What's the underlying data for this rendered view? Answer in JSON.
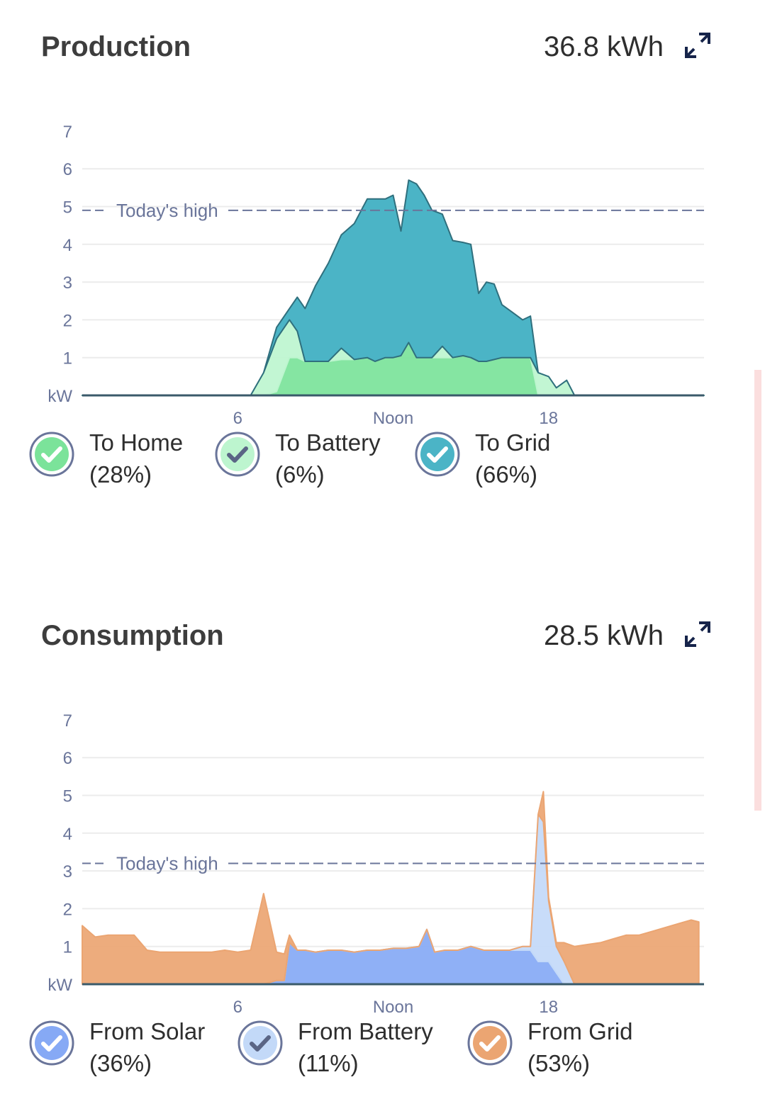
{
  "colors": {
    "to_home": "#7be39a",
    "to_battery": "#bdf5cf",
    "to_grid": "#4bb4c6",
    "to_grid_line": "#2f6f7d",
    "from_solar": "#86a9f5",
    "from_battery": "#c3d9f8",
    "from_grid": "#eba572",
    "grid_line": "#ececec",
    "axis": "#6a759a",
    "check_mark_dark": "#5a6585"
  },
  "production": {
    "title": "Production",
    "total": "36.8 kWh",
    "expand_icon": "expand-arrows-icon",
    "legend": [
      {
        "key": "to_home",
        "label": "To Home",
        "pct": "(28%)",
        "checked": true
      },
      {
        "key": "to_battery",
        "label": "To Battery",
        "pct": "(6%)",
        "checked": true
      },
      {
        "key": "to_grid",
        "label": "To Grid",
        "pct": "(66%)",
        "checked": true
      }
    ]
  },
  "consumption": {
    "title": "Consumption",
    "total": "28.5 kWh",
    "expand_icon": "expand-arrows-icon",
    "legend": [
      {
        "key": "from_solar",
        "label": "From Solar",
        "pct": "(36%)",
        "checked": true
      },
      {
        "key": "from_battery",
        "label": "From Battery",
        "pct": "(11%)",
        "checked": true
      },
      {
        "key": "from_grid",
        "label": "From Grid",
        "pct": "(53%)",
        "checked": true
      }
    ]
  },
  "chart_data": [
    {
      "type": "area",
      "stacked": true,
      "title": "Production",
      "ylabel": "kW",
      "ylim": [
        0,
        7
      ],
      "yticks": [
        "kW",
        "1",
        "2",
        "3",
        "4",
        "5",
        "6",
        "7"
      ],
      "xlim": [
        0,
        24
      ],
      "xticks": [
        {
          "value": 6,
          "label": "6"
        },
        {
          "value": 12,
          "label": "Noon"
        },
        {
          "value": 18,
          "label": "18"
        }
      ],
      "reference_line": {
        "label": "Today's high",
        "value": 4.9
      },
      "x": [
        0,
        6.5,
        7.0,
        7.5,
        8.0,
        8.3,
        8.6,
        9.0,
        9.5,
        10.0,
        10.5,
        11.0,
        11.3,
        11.7,
        12.0,
        12.3,
        12.6,
        12.9,
        13.2,
        13.5,
        13.9,
        14.3,
        14.7,
        15.0,
        15.3,
        15.6,
        15.9,
        16.2,
        16.6,
        17.0,
        17.3,
        17.6,
        18.0,
        18.3,
        18.7,
        19.0,
        24
      ],
      "series": [
        {
          "name": "To Home",
          "color_key": "to_home",
          "values": [
            0,
            0,
            0,
            0.1,
            1.0,
            1.0,
            0.9,
            0.9,
            0.9,
            0.95,
            0.95,
            1.0,
            0.9,
            1.0,
            1.0,
            1.05,
            1.4,
            1.0,
            1.0,
            1.0,
            1.0,
            1.0,
            1.05,
            1.0,
            0.9,
            0.9,
            0.95,
            1.0,
            1.0,
            1.0,
            1.0,
            0,
            0,
            0,
            0,
            0,
            0
          ]
        },
        {
          "name": "To Battery",
          "color_key": "to_battery",
          "values": [
            0,
            0,
            0.6,
            1.4,
            1.0,
            0.7,
            0,
            0,
            0,
            0.3,
            0,
            0,
            0,
            0,
            0,
            0,
            0,
            0,
            0,
            0,
            0.3,
            0,
            0,
            0,
            0,
            0,
            0,
            0,
            0,
            0,
            0,
            0.6,
            0.5,
            0.2,
            0.4,
            0,
            0
          ]
        },
        {
          "name": "To Grid",
          "color_key": "to_grid",
          "values": [
            0,
            0,
            0,
            0.3,
            0.3,
            0.9,
            1.4,
            2.0,
            2.6,
            3.0,
            3.6,
            4.2,
            4.3,
            4.2,
            4.3,
            3.3,
            4.3,
            4.6,
            4.3,
            3.9,
            3.5,
            3.1,
            3.0,
            3.0,
            1.8,
            2.1,
            2.0,
            1.4,
            1.2,
            1.0,
            1.1,
            0,
            0,
            0,
            0,
            0,
            0
          ]
        }
      ]
    },
    {
      "type": "area",
      "stacked": true,
      "title": "Consumption",
      "ylabel": "kW",
      "ylim": [
        0,
        7
      ],
      "yticks": [
        "kW",
        "1",
        "2",
        "3",
        "4",
        "5",
        "6",
        "7"
      ],
      "xlim": [
        0,
        24
      ],
      "xticks": [
        {
          "value": 6,
          "label": "6"
        },
        {
          "value": 12,
          "label": "Noon"
        },
        {
          "value": 18,
          "label": "18"
        }
      ],
      "reference_line": {
        "label": "Today's high",
        "value": 3.2
      },
      "x": [
        0,
        0.5,
        1.0,
        1.5,
        2.0,
        2.5,
        3.0,
        3.5,
        4.0,
        4.5,
        5.0,
        5.5,
        6.0,
        6.5,
        7.0,
        7.5,
        7.8,
        8.0,
        8.3,
        8.6,
        9.0,
        9.5,
        10.0,
        10.5,
        11.0,
        11.5,
        12.0,
        12.5,
        13.0,
        13.3,
        13.6,
        14.0,
        14.5,
        15.0,
        15.5,
        16.0,
        16.5,
        17.0,
        17.3,
        17.6,
        17.8,
        18.0,
        18.3,
        18.6,
        19.0,
        19.5,
        20.0,
        20.5,
        21.0,
        21.5,
        22.0,
        22.5,
        23.0,
        23.5,
        23.8
      ],
      "series": [
        {
          "name": "From Solar",
          "color_key": "from_solar",
          "values": [
            0,
            0,
            0,
            0,
            0,
            0,
            0,
            0,
            0,
            0,
            0,
            0,
            0,
            0,
            0,
            0.1,
            0.1,
            1.1,
            0.9,
            0.9,
            0.85,
            0.9,
            0.9,
            0.85,
            0.9,
            0.9,
            0.95,
            0.95,
            1.0,
            1.45,
            0.85,
            0.9,
            0.9,
            1.0,
            0.9,
            0.9,
            0.9,
            0.9,
            0.9,
            0.6,
            0.6,
            0.6,
            0.3,
            0,
            0,
            0,
            0,
            0,
            0,
            0,
            0,
            0,
            0,
            0,
            0
          ]
        },
        {
          "name": "From Battery",
          "color_key": "from_battery",
          "values": [
            0,
            0,
            0,
            0,
            0,
            0,
            0,
            0,
            0,
            0,
            0,
            0,
            0,
            0,
            0,
            0,
            0,
            0,
            0,
            0,
            0,
            0,
            0,
            0,
            0,
            0,
            0,
            0,
            0,
            0,
            0,
            0,
            0,
            0,
            0,
            0,
            0,
            0.1,
            0.1,
            3.9,
            3.7,
            1.6,
            0.7,
            0.6,
            0,
            0,
            0,
            0,
            0,
            0,
            0,
            0,
            0,
            0,
            0
          ]
        },
        {
          "name": "From Grid",
          "color_key": "from_grid",
          "values": [
            1.55,
            1.25,
            1.3,
            1.3,
            1.3,
            0.9,
            0.85,
            0.85,
            0.85,
            0.85,
            0.85,
            0.9,
            0.85,
            0.9,
            2.4,
            0.75,
            0.7,
            0.2,
            0,
            0,
            0,
            0,
            0,
            0,
            0,
            0,
            0,
            0,
            0,
            0,
            0,
            0,
            0,
            0,
            0,
            0,
            0,
            0,
            0,
            0,
            0.8,
            0.1,
            0.1,
            0.5,
            1.0,
            1.05,
            1.1,
            1.2,
            1.3,
            1.3,
            1.4,
            1.5,
            1.6,
            1.7,
            1.65
          ]
        }
      ]
    }
  ]
}
